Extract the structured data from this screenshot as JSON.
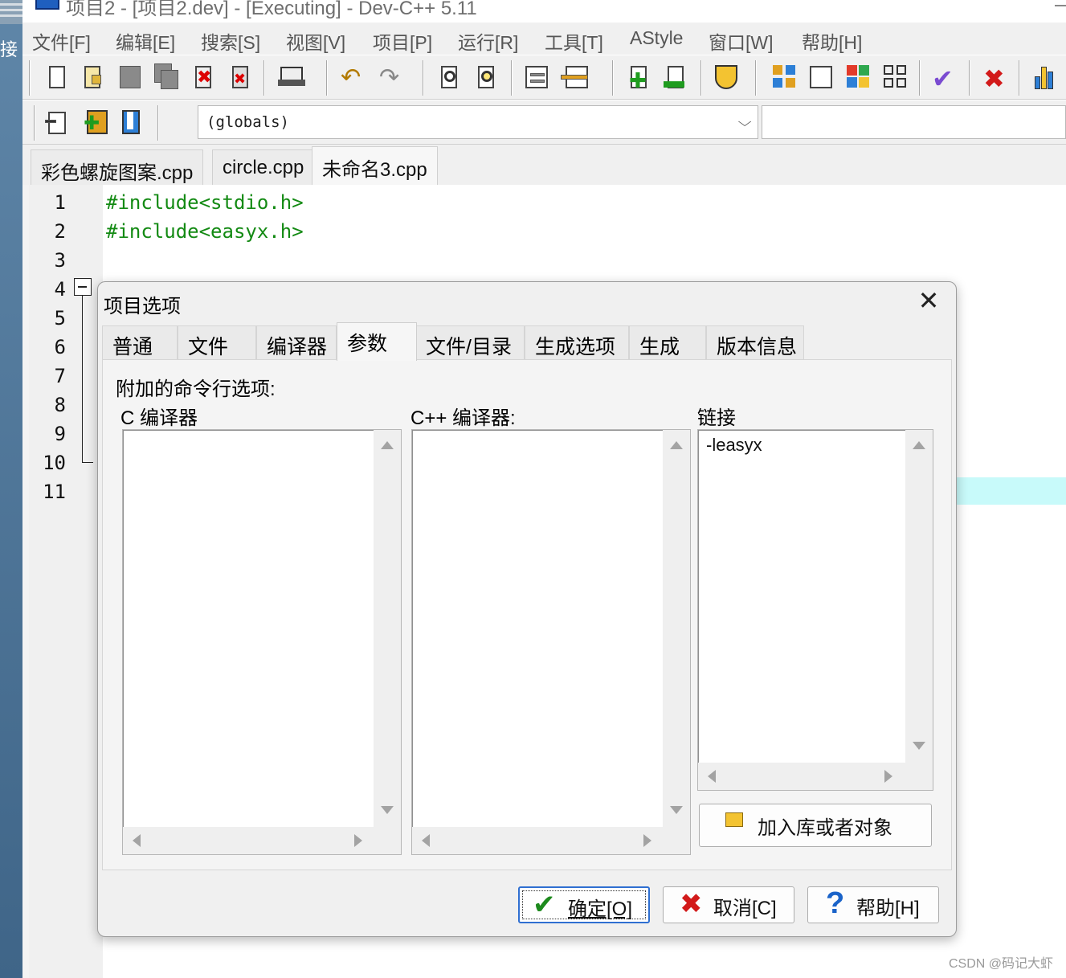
{
  "desktop": {
    "label": "接"
  },
  "window": {
    "title": "项目2 - [项目2.dev] - [Executing] - Dev-C++ 5.11"
  },
  "menu": [
    "文件[F]",
    "编辑[E]",
    "搜索[S]",
    "视图[V]",
    "项目[P]",
    "运行[R]",
    "工具[T]",
    "AStyle",
    "窗口[W]",
    "帮助[H]"
  ],
  "toolbar": {
    "scope_value": "(globals)",
    "icons": [
      "new-file-icon",
      "open-file-icon",
      "save-icon",
      "save-all-icon",
      "close-file-icon",
      "close-all-icon",
      "print-icon",
      "undo-icon",
      "redo-icon",
      "find-icon",
      "replace-icon",
      "goto-icon",
      "goto-line-icon",
      "add-to-project-icon",
      "remove-from-project-icon",
      "project-options-icon",
      "compile-icon",
      "run-icon",
      "compile-run-icon",
      "rebuild-icon",
      "syntax-check-icon",
      "stop-icon",
      "profile-icon"
    ]
  },
  "file_tabs": [
    "彩色螺旋图案.cpp",
    "circle.cpp",
    "未命名3.cpp"
  ],
  "active_file_tab": 2,
  "editor": {
    "line_numbers": [
      "1",
      "2",
      "3",
      "4",
      "5",
      "6",
      "7",
      "8",
      "9",
      "10",
      "11"
    ],
    "lines": [
      "#include<stdio.h>",
      "#include<easyx.h>"
    ]
  },
  "dialog": {
    "title": "项目选项",
    "close_symbol": "✕",
    "tabs": [
      "普通",
      "文件",
      "编译器",
      "参数",
      "文件/目录",
      "生成选项",
      "生成",
      "版本信息"
    ],
    "active_tab": 3,
    "section_label": "附加的命令行选项:",
    "c_compiler": {
      "label": "C 编译器",
      "value": ""
    },
    "cpp_compiler": {
      "label": "C++ 编译器:",
      "value": ""
    },
    "linker": {
      "label": "链接",
      "value": "-leasyx"
    },
    "add_lib_button": "加入库或者对象",
    "ok_button": "确定[O]",
    "cancel_button": "取消[C]",
    "help_button": "帮助[H]"
  },
  "watermark": "CSDN @码记大虾",
  "colors": {
    "code_green": "#138a13",
    "highlight_cyan": "#c8fafa",
    "focus_blue": "#2f6fd1"
  }
}
